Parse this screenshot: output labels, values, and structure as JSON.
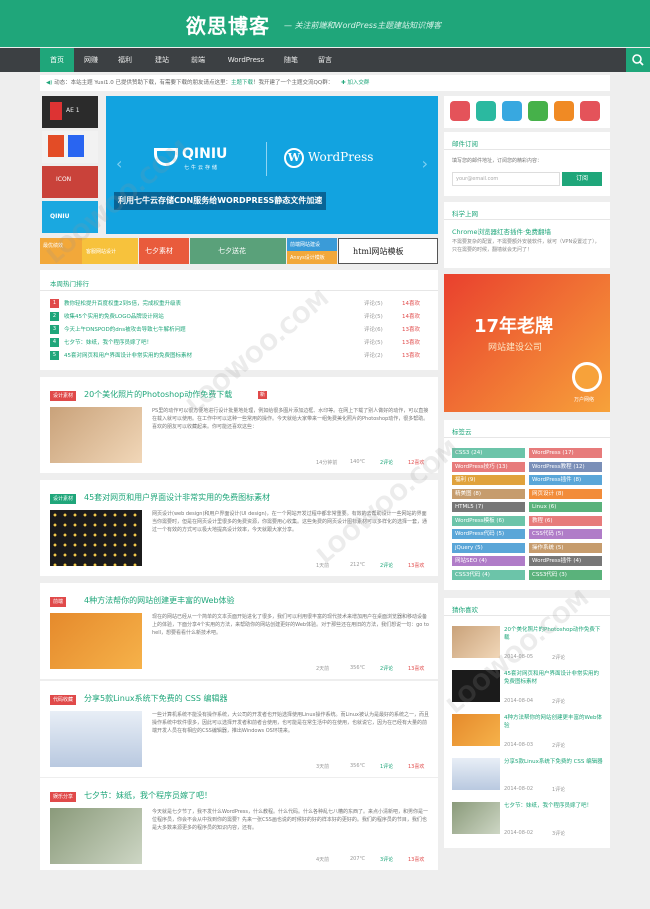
{
  "site": {
    "logo": "欲思博客",
    "slogan": "— 关注前端和WordPress主题建站知识博客"
  },
  "nav": [
    "首页",
    "网赚",
    "福利",
    "建站",
    "前端",
    "WordPress",
    "随笔",
    "留言"
  ],
  "announce": {
    "label": "动态：",
    "text": "本站主题 Yusi1.0 已提供赞助下载，有需要下载的朋友请点这里：",
    "link": "主题下载",
    "text2": "！我开建了一个主题交流QQ群：",
    "join": "加入交群"
  },
  "slider": {
    "logo_left": "QINIU",
    "logo_left_sub": "七牛云存储",
    "logo_right": "WordPress",
    "caption": "利用七牛云存储CDN服务给WORDPRESS静态文件加速"
  },
  "thumbs": [
    "AE 1",
    "HTML5 CSS3",
    "ICON",
    "QINIU"
  ],
  "promo": [
    "最优绩效",
    "客服网站设计",
    "七夕素材",
    "七夕送花",
    "前端网站建设",
    "html网站模板",
    "Ansys设计模板"
  ],
  "hot": {
    "title": "本周热门排行",
    "items": [
      {
        "no": "1",
        "text": "教你轻松提升百度权重2到5倍，完成权重升级表",
        "comments": "评论(5)",
        "likes": "14喜欢"
      },
      {
        "no": "2",
        "text": "收集45个实用的免费LOGO品牌设计网站",
        "comments": "评论(5)",
        "likes": "14喜欢"
      },
      {
        "no": "3",
        "text": "今天上午DNSPOD的dns被攻击导致七牛解析问题",
        "comments": "评论(6)",
        "likes": "13喜欢"
      },
      {
        "no": "4",
        "text": "七夕节：妹纸，我个程序员嫁了吧！",
        "comments": "评论(5)",
        "likes": "13喜欢"
      },
      {
        "no": "5",
        "text": "45套对网页和用户界面设计非常实用的免费图标素材",
        "comments": "评论(2)",
        "likes": "13喜欢"
      }
    ]
  },
  "posts": [
    {
      "cat": "设计素材",
      "title": "20个美化照片的Photoshop动作免费下载",
      "badge": "新",
      "excerpt": "PS里的动作可以很方便地进行设计批量地处理，例如给很多图片添加边框、水印等。在网上下载了别人做好的动作，可以直接在载入就可以使用。在工作中可以这种一些常用的操作。今天就给大家带来一组免费美化照片的Photoshop动作，很多帮助。喜欢的朋友可以收藏起来。你可能还喜欢这些：",
      "views": "14分钟前",
      "reads": "140℃",
      "comments": "2评论",
      "likes": "12喜欢"
    },
    {
      "cat": "设计素材",
      "title": "45套对网页和用户界面设计非常实用的免费图标素材",
      "badge": "",
      "excerpt": "网页设计(web design)和用户界面设计(UI design)，在一个网站开发过程中都非常重要。有效的去帮助设计一些网站的界面当你需要时，但是在网页设计里很多的免费资源，你需要用心收集。这些免费的网页设计图标素材可以多样化的选择一套，通过一个有效的方式可以极大地提高设计效率，今天就跟大家分享。",
      "views": "1天前",
      "reads": "212℃",
      "comments": "2评论",
      "likes": "13喜欢"
    },
    {
      "cat": "前端",
      "title": "4种方法帮你的网站创建更丰富的Web体验",
      "badge": "",
      "excerpt": "现在的网站已经从一个简单的文本页面开始进化了很多，我们可以利用很丰富的现代技术来增加用户在桌面浏览器和移动设备上的体验，下面分享4个实用的方法，来帮助你的网站创建更好的Web体验。对于那些还在用旧的方法，我们想说一句：go to hell，想要看看什么新技术吧。",
      "views": "2天前",
      "reads": "356℃",
      "comments": "2评论",
      "likes": "13喜欢"
    },
    {
      "cat": "代码收藏",
      "title": "分享5款Linux系统下免费的 CSS 编辑器",
      "badge": "",
      "excerpt": "一些计算机系统不能没有操作系统，大公司的开发者也开始选择使用Linux操作系统。而Linux被认为是最好的系统之一，而且操作系统中软件很多，因此可以选择开发者和前者合使用，也可能是在常生活中的在使用，也就说它，因为在已经有大量的前端开发人员在有相应的CSS编辑器，推出Windows OS环境来。",
      "views": "3天前",
      "reads": "356℃",
      "comments": "1评论",
      "likes": "13喜欢"
    },
    {
      "cat": "娱乐分享",
      "title": "七夕节：妹纸，我个程序员嫁了吧！",
      "badge": "",
      "excerpt": "今天就是七夕节了，我不发什么WordPress，什么教程。什么代码。什么各种乱七八糟的东西了。来点小清新吧，和男你是一位程序员，你会不会从中找到你的需要？先来一张CSS画也说的时候好的好的样本好的更好的。我们的程序员的节目，我们也是大多数来源更多的程序员的知识内容，还有。",
      "views": "4天前",
      "reads": "207℃",
      "comments": "3评论",
      "likes": "13喜欢"
    }
  ],
  "sidebar": {
    "subscribe": {
      "title": "邮件订阅",
      "desc": "填写您的邮件地址，订阅您的精彩内容：",
      "placeholder": "your@email.com",
      "button": "订阅"
    },
    "science": {
      "title": "科学上网",
      "link": "Chrome浏览器红杏插件·免费翻墙",
      "desc": "不需要复杂的配置，不需要额外安装软件，就可（VPN设置过了），只在需要的时候，翻墙就会无问了！"
    },
    "ad": {
      "headline": "17年老牌",
      "sub": "网站建设公司",
      "brand": "万户网络"
    },
    "tags": {
      "title": "标签云",
      "items": [
        {
          "name": "CSS3 (24)",
          "color": "#6cc4a9"
        },
        {
          "name": "WordPress (17)",
          "color": "#e77b7b"
        },
        {
          "name": "WordPress技巧 (13)",
          "color": "#e77b7b"
        },
        {
          "name": "WordPress教程 (12)",
          "color": "#7a8fb8"
        },
        {
          "name": "福利 (9)",
          "color": "#e0a23c"
        },
        {
          "name": "WordPress插件 (8)",
          "color": "#5aa6d8"
        },
        {
          "name": "精美图 (8)",
          "color": "#c69c6d"
        },
        {
          "name": "网页设计 (8)",
          "color": "#f28c3a"
        },
        {
          "name": "HTML5 (7)",
          "color": "#777"
        },
        {
          "name": "Linux (6)",
          "color": "#5ab27b"
        },
        {
          "name": "WordPress模板 (6)",
          "color": "#6cc4a9"
        },
        {
          "name": "教程 (6)",
          "color": "#e77b7b"
        },
        {
          "name": "WordPress代码 (5)",
          "color": "#5aa6d8"
        },
        {
          "name": "CSS代码 (5)",
          "color": "#b07cc8"
        },
        {
          "name": "jQuery (5)",
          "color": "#5aa6d8"
        },
        {
          "name": "操作系统 (5)",
          "color": "#c69c6d"
        },
        {
          "name": "网站SEO (4)",
          "color": "#b07cc8"
        },
        {
          "name": "WordPress插件 (4)",
          "color": "#777"
        },
        {
          "name": "CSS3代码 (4)",
          "color": "#6cc4a9"
        },
        {
          "name": "CSS3代码 (3)",
          "color": "#5ab27b"
        }
      ]
    },
    "guess": {
      "title": "猜你喜欢",
      "items": [
        {
          "title": "20个美化照片的Photoshop动作免费下载",
          "date": "2014-08-05",
          "comments": "2评论"
        },
        {
          "title": "45套对网页和用户界面设计非常实用的免费图标素材",
          "date": "2014-08-04",
          "comments": "2评论"
        },
        {
          "title": "4种方法帮你的网站创建更丰富的Web体验",
          "date": "2014-08-03",
          "comments": "2评论"
        },
        {
          "title": "分享5款Linux系统下免费的 CSS 编辑器",
          "date": "2014-08-02",
          "comments": "1评论"
        },
        {
          "title": "七夕节：妹纸，我个程序员嫁了吧！",
          "date": "2014-08-02",
          "comments": "3评论"
        }
      ]
    }
  },
  "colors": {
    "brand": "#1fa67a",
    "nav": "#3c4043",
    "accent_red": "#e04a4a"
  }
}
